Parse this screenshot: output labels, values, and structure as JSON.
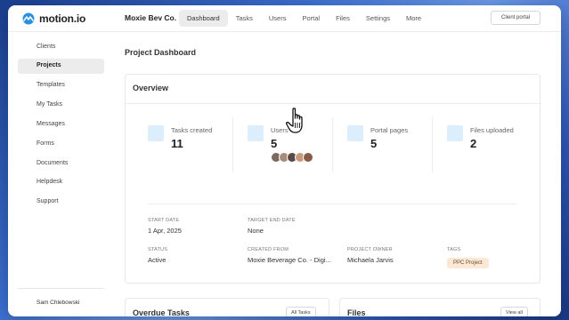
{
  "brand": {
    "name": "motion.io",
    "accent": "#2b8fe0"
  },
  "header": {
    "company": "Moxie Bev Co.",
    "nav": [
      "Dashboard",
      "Tasks",
      "Users",
      "Portal",
      "Files",
      "Settings",
      "More"
    ],
    "active_nav": "Dashboard",
    "client_portal_label": "Client portal"
  },
  "sidebar": {
    "items": [
      "Clients",
      "Projects",
      "Templates",
      "My Tasks",
      "Messages",
      "Forms",
      "Documents",
      "Helpdesk",
      "Support"
    ],
    "active": "Projects",
    "user": "Sam Chlebowski"
  },
  "main": {
    "page_title": "Project Dashboard",
    "overview": {
      "title": "Overview",
      "stats": [
        {
          "label": "Tasks created",
          "value": "11"
        },
        {
          "label": "Users",
          "value": "5"
        },
        {
          "label": "Portal pages",
          "value": "5"
        },
        {
          "label": "Files uploaded",
          "value": "2"
        }
      ],
      "details": {
        "start_date_label": "START DATE",
        "start_date": "1 Apr, 2025",
        "target_end_date_label": "TARGET END DATE",
        "target_end_date": "None",
        "status_label": "STATUS",
        "status": "Active",
        "created_from_label": "CREATED FROM",
        "created_from": "Moxie Beverage Co. - Digi...",
        "project_owner_label": "PROJECT OWNER",
        "project_owner": "Michaela Jarvis",
        "tags_label": "TAGS",
        "tag": "PPC Project"
      }
    },
    "overdue": {
      "title": "Overdue Tasks",
      "button": "All Tasks"
    },
    "files": {
      "title": "Files",
      "button": "View all"
    }
  },
  "icons": {
    "cursor": "hand-pointer-icon",
    "avatar_colors": [
      "#7a6a60",
      "#a88c7a",
      "#5b4a44",
      "#c79a7e",
      "#8a5a48"
    ]
  }
}
